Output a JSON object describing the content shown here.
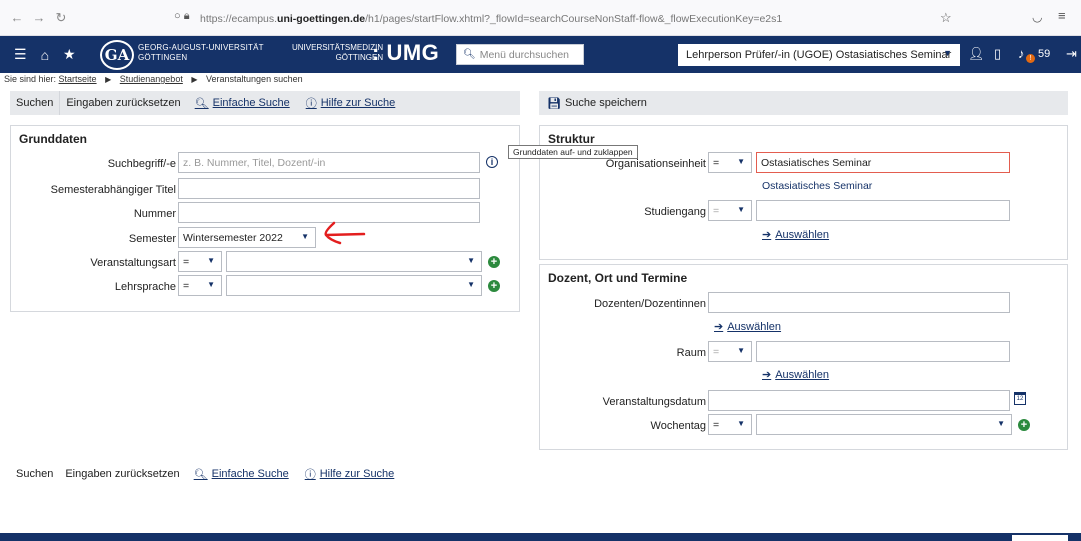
{
  "browser": {
    "url_prefix": "https://ecampus.",
    "url_domain": "uni-goettingen.de",
    "url_suffix": "/h1/pages/startFlow.xhtml?_flowId=searchCourseNonStaff-flow&_flowExecutionKey=e2s1"
  },
  "header": {
    "logo_text": "GA",
    "university_line1": "GEORG-AUGUST-UNIVERSITÄT",
    "university_line2": "GÖTTINGEN",
    "umg_line1": "UNIVERSITÄTSMEDIZIN",
    "umg_line2": "GÖTTINGEN",
    "umg_mark": ": UMG",
    "menu_search_placeholder": "Menü durchsuchen",
    "role": "Lehrperson  Prüfer/-in (UGOE) Ostasiatisches Seminar",
    "notification_count": "59",
    "badge": "!"
  },
  "breadcrumb": {
    "prefix": "Sie sind hier:",
    "items": [
      "Startseite",
      "Studienangebot",
      "Veranstaltungen suchen"
    ]
  },
  "actions": {
    "search": "Suchen",
    "reset": "Eingaben zurücksetzen",
    "simple_search": "Einfache Suche",
    "help": "Hilfe zur Suche",
    "save_search": "Suche speichern"
  },
  "grunddaten": {
    "title": "Grunddaten",
    "suchbegriff_label": "Suchbegriff/-e",
    "suchbegriff_placeholder": "z. B. Nummer, Titel, Dozent/-in",
    "semestertitel_label": "Semesterabhängiger Titel",
    "nummer_label": "Nummer",
    "semester_label": "Semester",
    "semester_value": "Wintersemester 2022",
    "veranstaltungsart_label": "Veranstaltungsart",
    "lehrsprache_label": "Lehrsprache",
    "op_value": "="
  },
  "tooltip": "Grunddaten auf- und zuklappen",
  "struktur": {
    "title": "Struktur",
    "org_label": "Organisationseinheit",
    "org_op": "=",
    "org_value": "Ostasiatisches Seminar",
    "org_hint": "Ostasiatisches Seminar",
    "studiengang_label": "Studiengang",
    "studiengang_op": "=",
    "auswaehlen": "Auswählen"
  },
  "dozent": {
    "title": "Dozent, Ort und Termine",
    "dozenten_label": "Dozenten/Dozentinnen",
    "raum_label": "Raum",
    "raum_op": "=",
    "datum_label": "Veranstaltungsdatum",
    "wochentag_label": "Wochentag",
    "wochentag_op": "=",
    "auswaehlen": "Auswählen",
    "calendar_day": "12"
  }
}
